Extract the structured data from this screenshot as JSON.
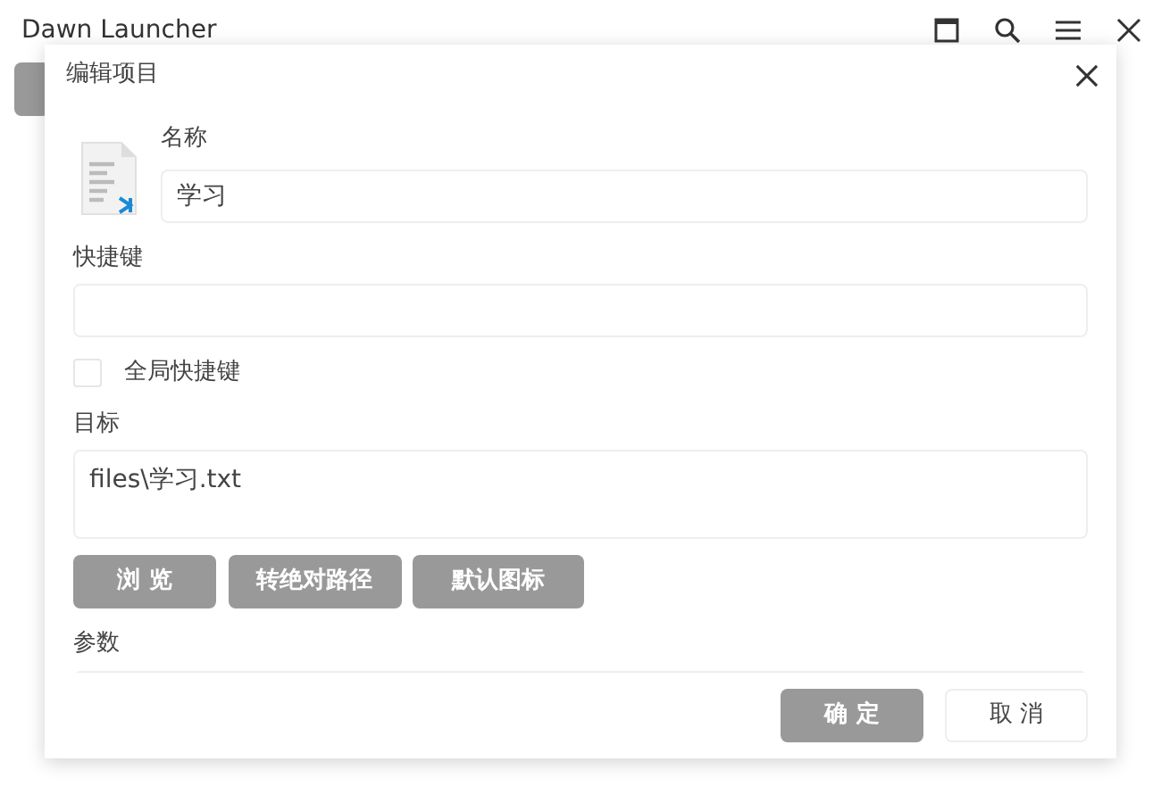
{
  "window": {
    "title": "Dawn Launcher"
  },
  "dialog": {
    "title": "编辑项目",
    "name_label": "名称",
    "name_value": "学习",
    "hotkey_label": "快捷键",
    "global_hotkey": {
      "label": "全局快捷键",
      "checked": false
    },
    "target_label": "目标",
    "target_value": "files\\学习.txt",
    "target_buttons": [
      "浏 览",
      "转绝对路径",
      "默认图标"
    ],
    "params_label": "参数",
    "footer_buttons": [
      {
        "label": "确 定",
        "kind": "primary"
      },
      {
        "label": "取 消",
        "kind": "secondary"
      }
    ]
  }
}
